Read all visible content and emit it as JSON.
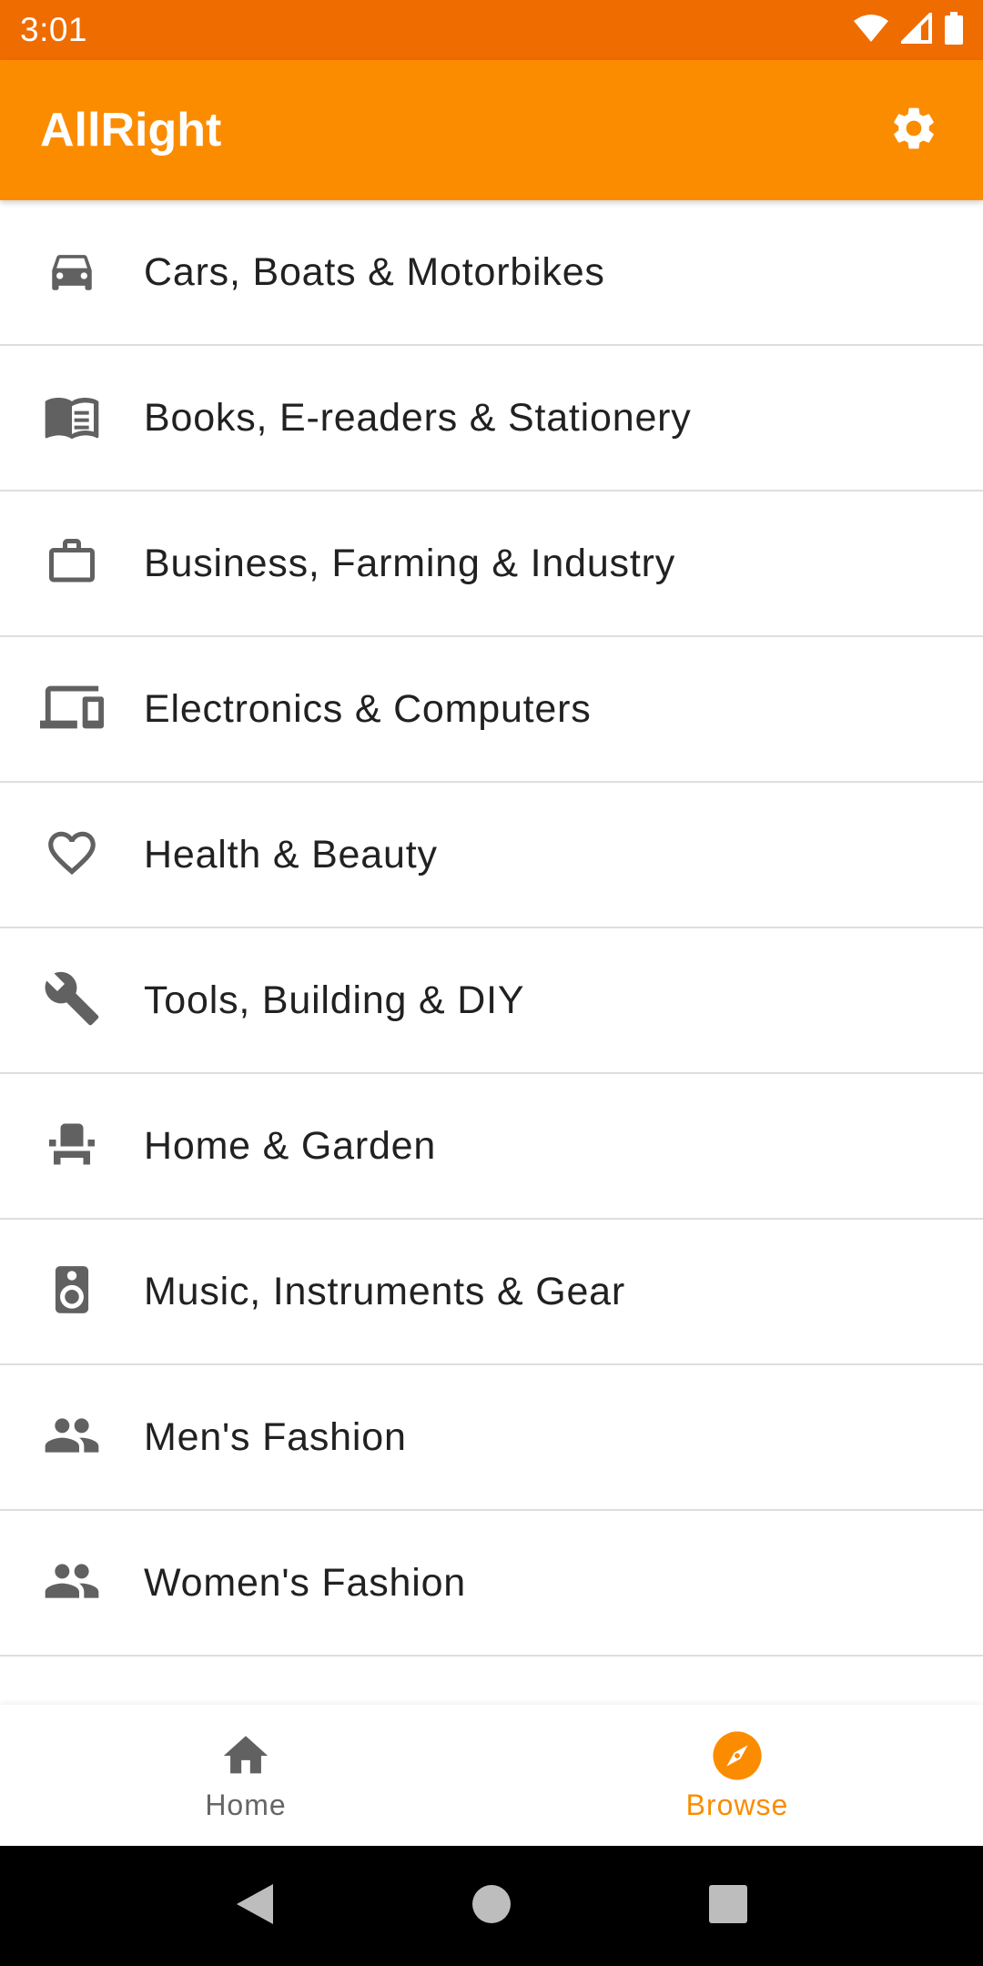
{
  "status_bar": {
    "time": "3:01",
    "icons": [
      "wifi-icon",
      "signal-icon",
      "battery-icon"
    ],
    "color": "#ef6c00"
  },
  "app_bar": {
    "title": "AllRight",
    "action_icon": "gear-icon",
    "color": "#fb8c00"
  },
  "categories": [
    {
      "label": "Cars, Boats & Motorbikes",
      "icon": "car-icon"
    },
    {
      "label": "Books, E-readers & Stationery",
      "icon": "book-icon"
    },
    {
      "label": "Business, Farming & Industry",
      "icon": "briefcase-icon"
    },
    {
      "label": "Electronics & Computers",
      "icon": "devices-icon"
    },
    {
      "label": "Health & Beauty",
      "icon": "heart-icon"
    },
    {
      "label": "Tools, Building & DIY",
      "icon": "wrench-icon"
    },
    {
      "label": "Home & Garden",
      "icon": "chair-icon"
    },
    {
      "label": "Music, Instruments & Gear",
      "icon": "speaker-icon"
    },
    {
      "label": "Men's Fashion",
      "icon": "people-icon"
    },
    {
      "label": "Women's Fashion",
      "icon": "people-icon"
    }
  ],
  "bottom_nav": {
    "home_label": "Home",
    "browse_label": "Browse",
    "active": "Browse",
    "active_color": "#fb8c00",
    "inactive_color": "#666666"
  },
  "system_nav": {
    "icons": [
      "back-icon",
      "home-circle-icon",
      "recents-icon"
    ]
  }
}
